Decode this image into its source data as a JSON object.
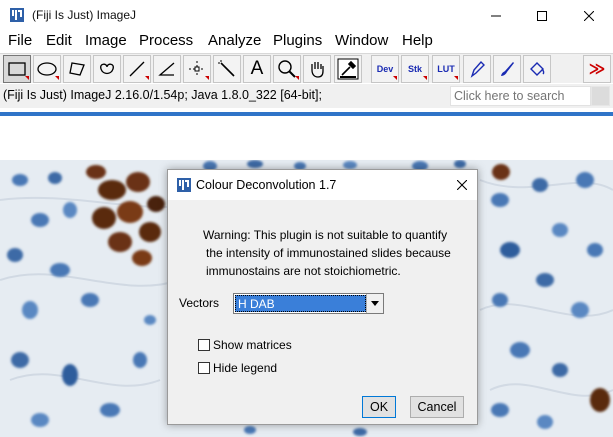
{
  "main_window": {
    "title": "(Fiji Is Just) ImageJ",
    "icon": "imagej-app-icon",
    "controls": [
      "minimize-icon",
      "maximize-icon",
      "close-icon"
    ]
  },
  "menubar": {
    "items": [
      "File",
      "Edit",
      "Image",
      "Process",
      "Analyze",
      "Plugins",
      "Window",
      "Help"
    ]
  },
  "toolbar": {
    "tools": [
      {
        "name": "rectangle-tool",
        "icon": "rectangle-icon"
      },
      {
        "name": "oval-tool",
        "icon": "oval-icon"
      },
      {
        "name": "polygon-tool",
        "icon": "polygon-icon"
      },
      {
        "name": "freehand-tool",
        "icon": "freehand-icon"
      },
      {
        "name": "line-tool",
        "icon": "line-icon"
      },
      {
        "name": "angle-tool",
        "icon": "angle-icon"
      },
      {
        "name": "point-tool",
        "icon": "point-icon"
      },
      {
        "name": "wand-tool",
        "icon": "wand-icon"
      },
      {
        "name": "text-tool",
        "icon": "text-icon",
        "label": "A"
      },
      {
        "name": "magnifier-tool",
        "icon": "magnifier-icon"
      },
      {
        "name": "hand-tool",
        "icon": "hand-icon"
      },
      {
        "name": "color-picker-tool",
        "icon": "dropper-icon"
      },
      {
        "name": "dev-menu",
        "label": "Dev"
      },
      {
        "name": "stk-menu",
        "label": "Stk"
      },
      {
        "name": "lut-menu",
        "label": "LUT"
      },
      {
        "name": "pencil-tool",
        "icon": "pencil-icon"
      },
      {
        "name": "brush-tool",
        "icon": "brush-icon"
      },
      {
        "name": "flood-fill-tool",
        "icon": "bucket-icon"
      },
      {
        "name": "more-tools",
        "icon": "double-chevron-right-icon",
        "label": "≫"
      }
    ]
  },
  "statusbar": {
    "text": "(Fiji Is Just) ImageJ 2.16.0/1.54p; Java 1.8.0_322 [64-bit];",
    "search_placeholder": "Click here to search"
  },
  "dialog": {
    "title": "Colour Deconvolution 1.7",
    "warning_lines": [
      "Warning: This plugin is not suitable to quantify",
      "the intensity of immunostained slides because",
      "immunostains are not stoichiometric."
    ],
    "vectors_label": "Vectors",
    "vectors_value": "H DAB",
    "show_matrices_label": "Show matrices",
    "show_matrices_checked": false,
    "hide_legend_label": "Hide legend",
    "hide_legend_checked": false,
    "ok_label": "OK",
    "cancel_label": "Cancel"
  },
  "colors": {
    "accent_blue": "#2f74c8",
    "selection_blue": "#3a7fd9",
    "hematoxylin_blue": "#4a78b5",
    "dab_brown": "#5a2a10"
  }
}
